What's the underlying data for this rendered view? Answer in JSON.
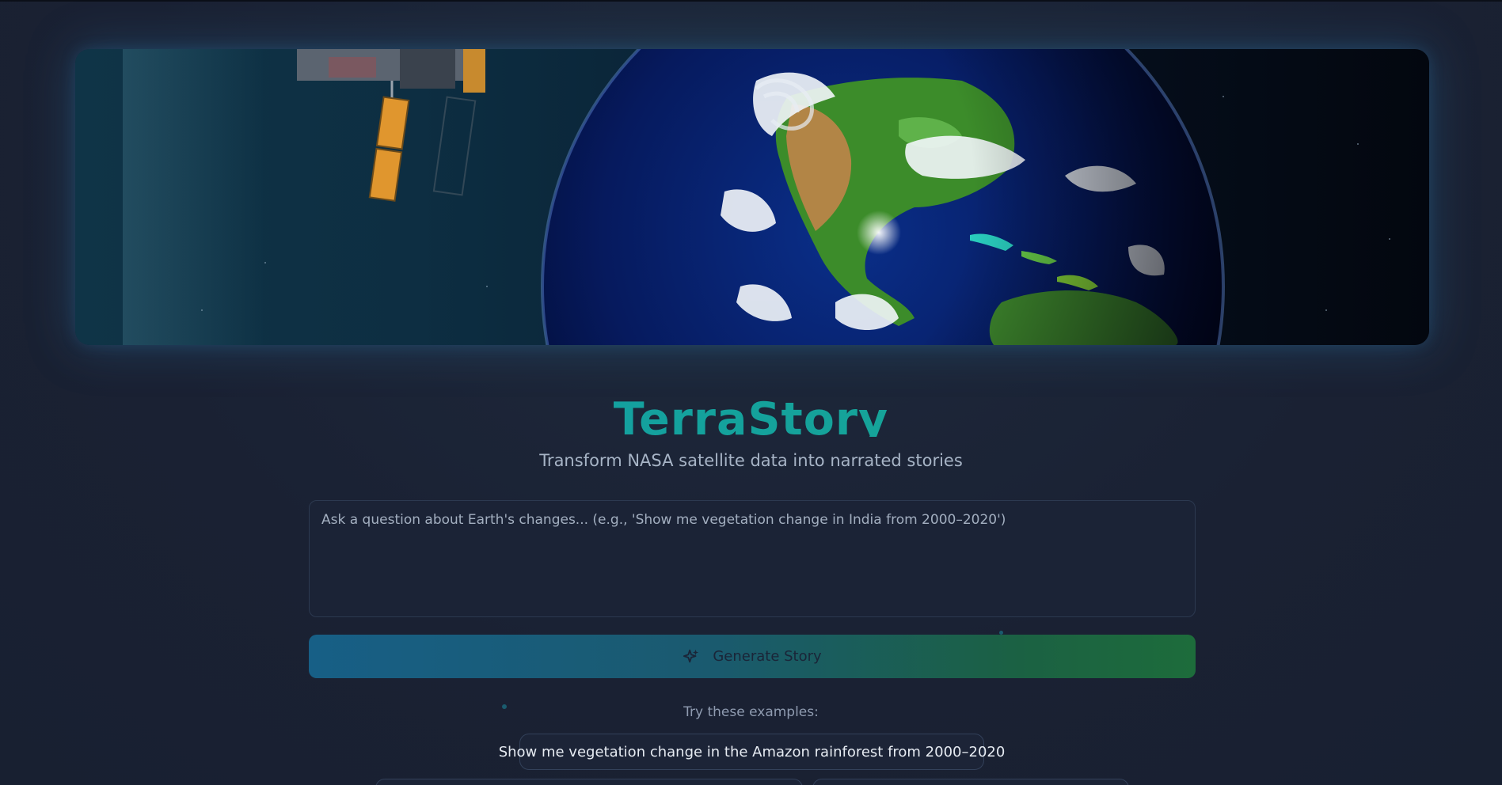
{
  "app": {
    "title": "TerraStory",
    "subtitle": "Transform NASA satellite data into narrated stories"
  },
  "hero": {
    "image_name": "satellite-earth-hero"
  },
  "query": {
    "placeholder": "Ask a question about Earth's changes... (e.g., 'Show me vegetation change in India from 2000–2020')",
    "value": ""
  },
  "generate_button": {
    "label": "Generate Story",
    "icon": "sparkle-icon"
  },
  "examples": {
    "label": "Try these examples:",
    "items": [
      "Show me vegetation change in the Amazon rainforest from 2000–2020",
      "",
      ""
    ]
  },
  "colors": {
    "accent_teal": "#14a3a0",
    "button_gradient_start": "#175f86",
    "button_gradient_end": "#1d6c3b",
    "background": "#1a2133"
  }
}
